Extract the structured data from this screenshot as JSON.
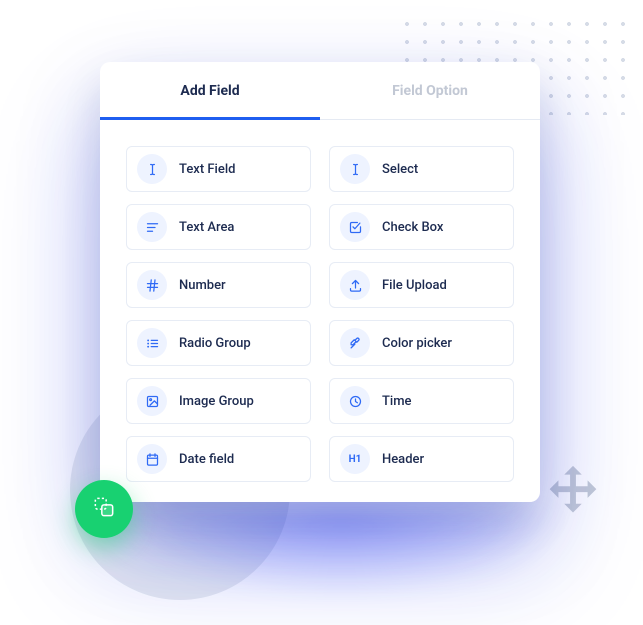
{
  "tabs": [
    {
      "label": "Add Field",
      "active": true
    },
    {
      "label": "Field Option",
      "active": false
    }
  ],
  "fields": [
    {
      "label": "Text Field",
      "icon": "text-cursor-icon"
    },
    {
      "label": "Select",
      "icon": "text-cursor-icon"
    },
    {
      "label": "Text Area",
      "icon": "align-left-icon"
    },
    {
      "label": "Check Box",
      "icon": "checkbox-icon"
    },
    {
      "label": "Number",
      "icon": "hash-icon"
    },
    {
      "label": "File Upload",
      "icon": "upload-icon"
    },
    {
      "label": "Radio Group",
      "icon": "list-icon"
    },
    {
      "label": "Color picker",
      "icon": "eyedropper-icon"
    },
    {
      "label": "Image Group",
      "icon": "image-icon"
    },
    {
      "label": "Time",
      "icon": "clock-icon"
    },
    {
      "label": "Date field",
      "icon": "calendar-icon"
    },
    {
      "label": "Header",
      "icon": "h1-icon"
    }
  ],
  "colors": {
    "primary": "#2f6af5",
    "text": "#1d2b50",
    "muted": "#c2c8d4",
    "icon_bg": "#eef3ff",
    "fab": "#18d171",
    "border": "#e7ecf5"
  }
}
